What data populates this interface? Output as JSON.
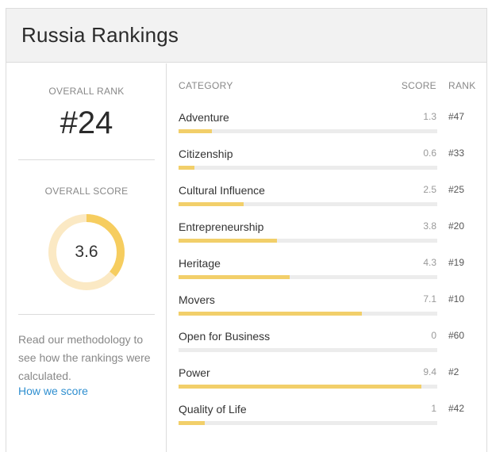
{
  "header": {
    "title": "Russia Rankings"
  },
  "overall": {
    "rank_label": "OVERALL RANK",
    "rank_value": "#24",
    "score_label": "OVERALL SCORE",
    "score_value": "3.6",
    "score_max": 10
  },
  "methodology": {
    "text": "Read our methodology to see how the rankings were calculated.",
    "link": "How we score"
  },
  "table": {
    "headers": {
      "category": "CATEGORY",
      "score": "SCORE",
      "rank": "RANK"
    },
    "rows": [
      {
        "name": "Adventure",
        "score": "1.3",
        "rank": "#47"
      },
      {
        "name": "Citizenship",
        "score": "0.6",
        "rank": "#33"
      },
      {
        "name": "Cultural Influence",
        "score": "2.5",
        "rank": "#25"
      },
      {
        "name": "Entrepreneurship",
        "score": "3.8",
        "rank": "#20"
      },
      {
        "name": "Heritage",
        "score": "4.3",
        "rank": "#19"
      },
      {
        "name": "Movers",
        "score": "7.1",
        "rank": "#10"
      },
      {
        "name": "Open for Business",
        "score": "0",
        "rank": "#60"
      },
      {
        "name": "Power",
        "score": "9.4",
        "rank": "#2"
      },
      {
        "name": "Quality of Life",
        "score": "1",
        "rank": "#42"
      }
    ],
    "score_max": 10
  },
  "colors": {
    "accent": "#f2cf6a",
    "gauge_track": "#fbe9c4",
    "gauge_fill": "#f6cd5f",
    "bar_track": "#ececec",
    "link": "#2f8fd0"
  }
}
